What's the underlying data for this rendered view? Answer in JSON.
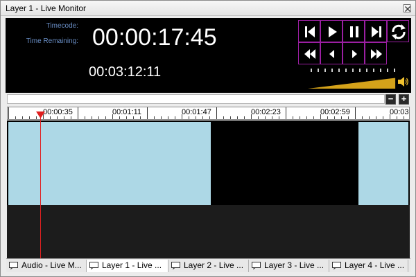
{
  "window": {
    "title": "Layer 1 - Live Monitor"
  },
  "monitor": {
    "timecode_label": "Timecode:",
    "timecode": "00:00:17:45",
    "remaining_label": "Time Remaining:",
    "remaining": "00:03:12:11"
  },
  "transport": {
    "buttons": [
      {
        "name": "skip-to-start-button",
        "icon": "skip-start-icon"
      },
      {
        "name": "play-button",
        "icon": "play-icon"
      },
      {
        "name": "pause-button",
        "icon": "pause-icon"
      },
      {
        "name": "skip-to-end-button",
        "icon": "skip-end-icon"
      },
      {
        "name": "loop-button",
        "icon": "loop-icon"
      },
      {
        "name": "rewind-button",
        "icon": "rewind-icon"
      },
      {
        "name": "step-back-button",
        "icon": "step-back-icon"
      },
      {
        "name": "step-forward-button",
        "icon": "step-forward-icon"
      },
      {
        "name": "fast-forward-button",
        "icon": "fast-forward-icon"
      }
    ],
    "accent_color": "#9b1fa2"
  },
  "zoom": {
    "minus": "−",
    "plus": "+"
  },
  "ruler": {
    "labels": [
      "00:00:35",
      "00:01:11",
      "00:01:47",
      "00:02:23",
      "00:02:59",
      "00:03:"
    ]
  },
  "volume": {
    "level": 0.97,
    "color": "#d4a21a"
  },
  "clip_color": "#add8e6",
  "tabs": [
    {
      "label": "Audio - Live M...",
      "active": false
    },
    {
      "label": "Layer 1 - Live ...",
      "active": true
    },
    {
      "label": "Layer 2 - Live ...",
      "active": false
    },
    {
      "label": "Layer 3 - Live ...",
      "active": false
    },
    {
      "label": "Layer 4 - Live ...",
      "active": false
    }
  ]
}
